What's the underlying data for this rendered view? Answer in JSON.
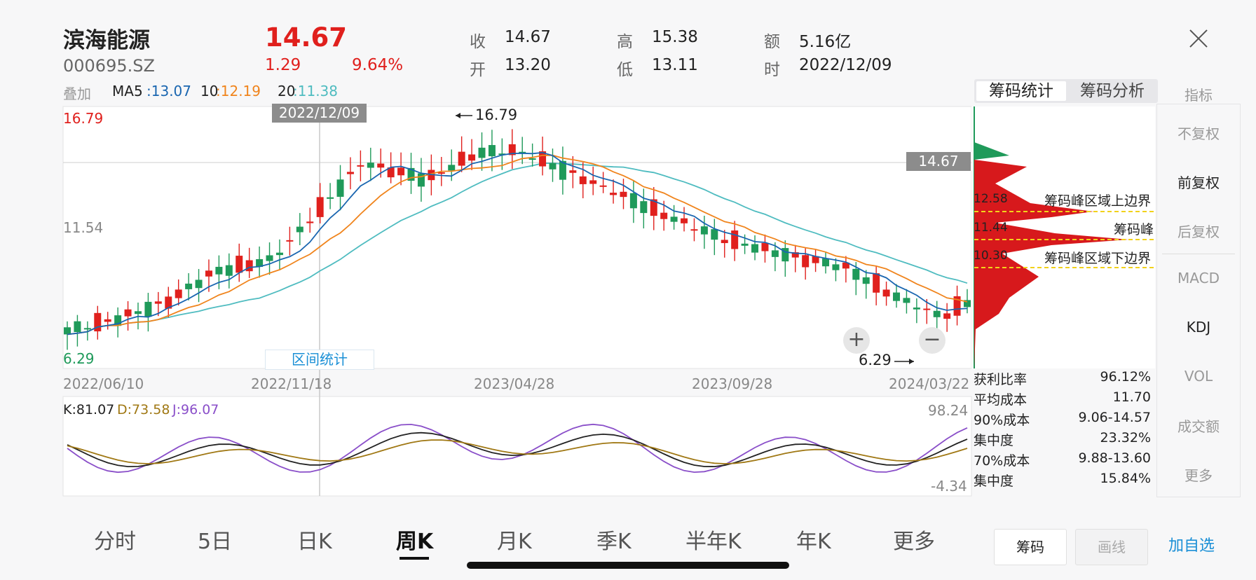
{
  "stock": {
    "name": "滨海能源",
    "code": "000695.SZ",
    "price": "14.67",
    "change": "1.29",
    "change_pct": "9.64%"
  },
  "quote": [
    {
      "k": "收",
      "v": "14.67"
    },
    {
      "k": "高",
      "v": "15.38"
    },
    {
      "k": "额",
      "v": "5.16亿"
    },
    {
      "k": "开",
      "v": "13.20"
    },
    {
      "k": "低",
      "v": "13.11"
    },
    {
      "k": "时",
      "v": "2022/12/09"
    }
  ],
  "ma_bar": {
    "overlay": "叠加",
    "ma5_label": "MA5",
    "ma5": ":13.07",
    "ma10_label": "10",
    "ma10": ":12.19",
    "ma20_label": "20",
    "ma20": ":11.38"
  },
  "chip_tabs": {
    "active": "筹码统计",
    "other": "筹码分析"
  },
  "side_menu": {
    "header": "指标",
    "items": [
      "不复权",
      "前复权",
      "后复权",
      "MACD",
      "KDJ",
      "VOL",
      "成交额",
      "更多"
    ]
  },
  "kchart": {
    "y_top": "16.79",
    "y_mid": "11.54",
    "y_bottom": "6.29",
    "crosshair_date": "2022/12/09",
    "last_price": "14.67",
    "high_label": "16.79",
    "low_label": "6.29",
    "range_button": "区间统计",
    "x_ticks": [
      "2022/06/10",
      "2022/11/18",
      "2023/04/28",
      "2023/09/28",
      "2024/03/22"
    ]
  },
  "chip_labels": {
    "upper_val": "12.58",
    "upper_text": "筹码峰区域上边界",
    "peak_val": "11.44",
    "peak_text": "筹码峰",
    "lower_val": "10.30",
    "lower_text": "筹码峰区域下边界"
  },
  "chip_stats": [
    {
      "k": "获利比率",
      "v": "96.12%"
    },
    {
      "k": "平均成本",
      "v": "11.70"
    },
    {
      "k": "90%成本",
      "v": "9.06-14.57"
    },
    {
      "k": "集中度",
      "v": "23.32%"
    },
    {
      "k": "70%成本",
      "v": "9.88-13.60"
    },
    {
      "k": "集中度",
      "v": "15.84%"
    }
  ],
  "kdj": {
    "k": "K:81.07",
    "d": "D:73.58",
    "j": "J:96.07",
    "max": "98.24",
    "min": "-4.34"
  },
  "period_tabs": [
    "分时",
    "5日",
    "日K",
    "周K",
    "月K",
    "季K",
    "半年K",
    "年K",
    "更多"
  ],
  "active_period": "周K",
  "buttons": {
    "chip": "筹码",
    "draw": "画线",
    "add": "加自选"
  },
  "colors": {
    "up": "#e0201d",
    "down": "#1f9a5a",
    "ma5": "#1a66b0",
    "ma10": "#f0841c",
    "ma20": "#4fbcc0",
    "accent": "#1a8fd6"
  }
}
